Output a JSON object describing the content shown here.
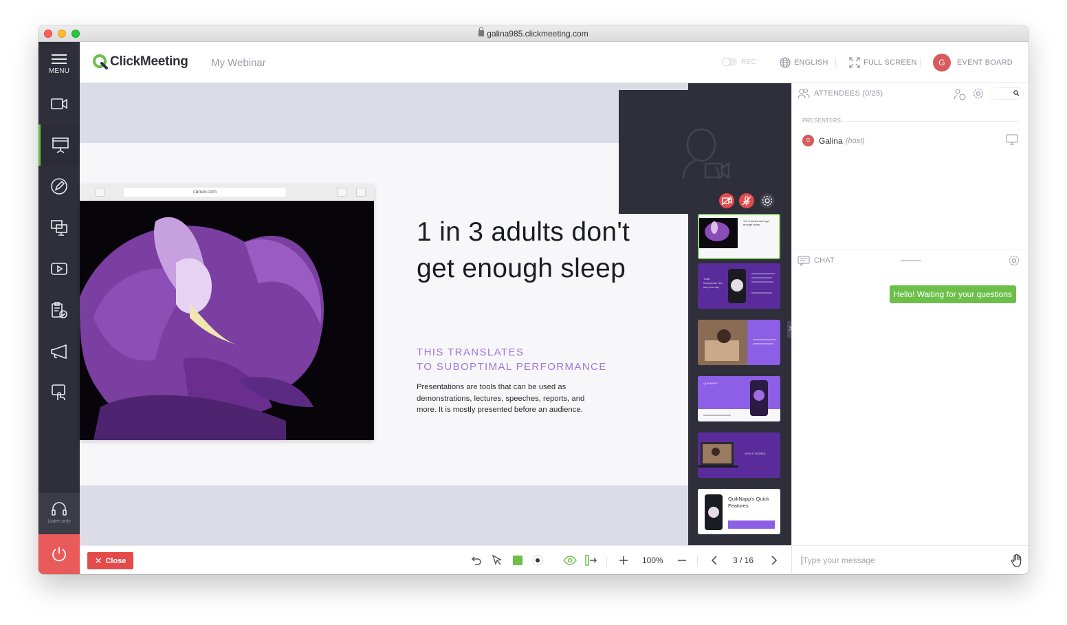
{
  "browser": {
    "url": "galina985.clickmeeting.com"
  },
  "sidebar": {
    "menu_label": "MENU",
    "items": [
      {
        "name": "webcam"
      },
      {
        "name": "presentation",
        "active": true
      },
      {
        "name": "whiteboard"
      },
      {
        "name": "screen-sharing"
      },
      {
        "name": "video"
      },
      {
        "name": "polls-surveys"
      },
      {
        "name": "call-to-action"
      },
      {
        "name": "interactions"
      }
    ],
    "listen_only_label": "Listen only"
  },
  "header": {
    "logo_text": "ClickMeeting",
    "webinar_title": "My Webinar",
    "rec_label": "REC",
    "language_label": "ENGLISH",
    "fullscreen_label": "FULL SCREEN",
    "user_initial": "G",
    "event_board_label": "EVENT BOARD"
  },
  "slide": {
    "browser_url": "canva.com",
    "title_line1": "1 in 3 adults don't",
    "title_line2": "get enough sleep",
    "subtitle_line1": "THIS TRANSLATES",
    "subtitle_line2": "TO SUBOPTIMAL PERFORMANCE",
    "body": "Presentations are tools that can be used as demonstrations, lectures, speeches, reports, and more. It is mostly presented before an audience."
  },
  "thumbnails": [
    {
      "caption": "1 in 3 adults don't get enough sleep",
      "active": true
    },
    {
      "caption": "Treat incorporate rest into your day"
    },
    {
      "caption": ""
    },
    {
      "caption": "QUIKNAPP"
    },
    {
      "caption": "HOW IT WORKS"
    },
    {
      "caption": "QuikNapp's Quick Features"
    }
  ],
  "attendees": {
    "title": "ATTENDEES (0/25)",
    "presenters_label": "PRESENTERS",
    "presenter_initial": "G",
    "presenter_name": "Galina",
    "presenter_role": "(host)"
  },
  "chat": {
    "title": "CHAT",
    "message": "Hello! Waiting for your questions",
    "input_placeholder": "Type your message"
  },
  "toolbar": {
    "close_label": "Close",
    "zoom": "100%",
    "page_indicator": "3 / 16",
    "accent_color": "#6cc04a"
  },
  "colors": {
    "sidebar_bg": "#2e2f3a",
    "accent_green": "#6cc04a",
    "danger_red": "#e44a4a",
    "slide_purple": "#9f76d9"
  }
}
